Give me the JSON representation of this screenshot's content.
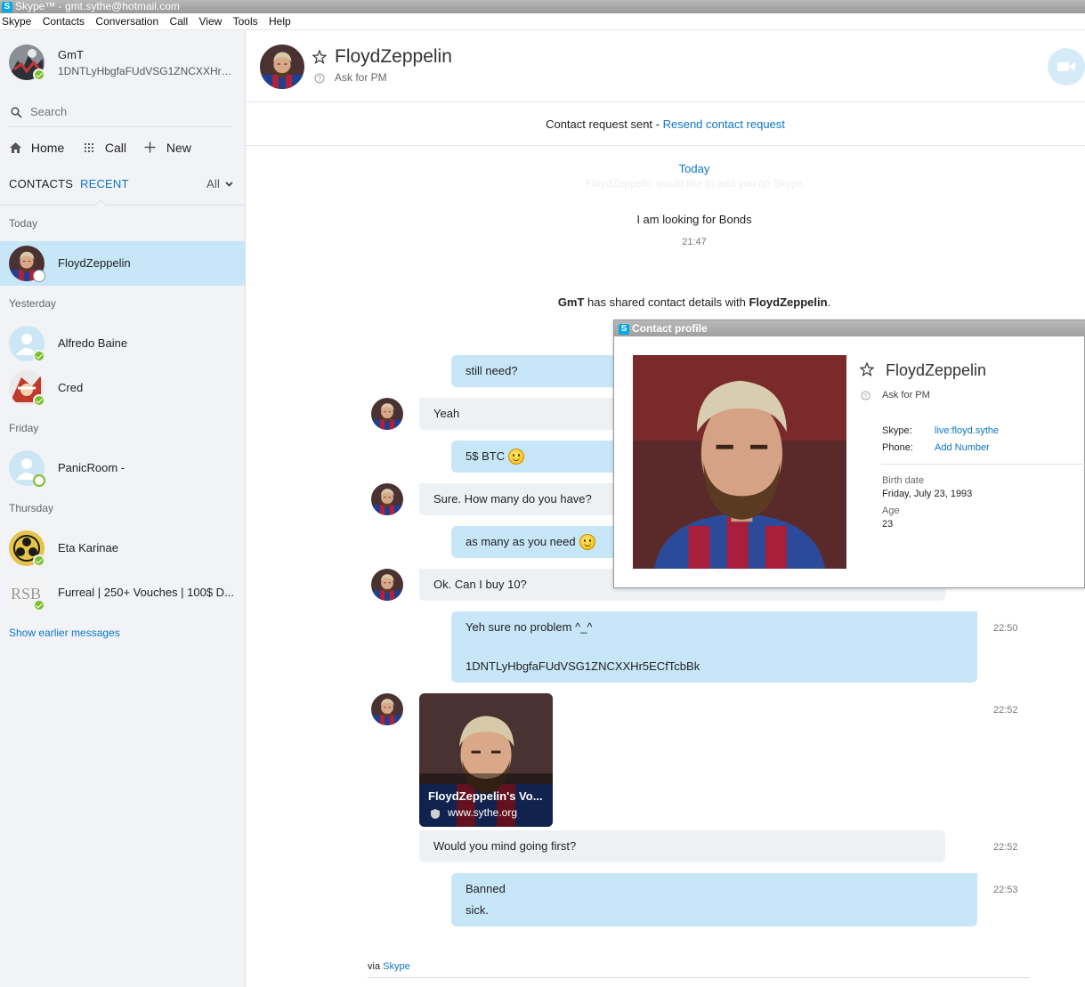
{
  "window": {
    "title": "Skype™ - gmt.sythe@hotmail.com"
  },
  "menu": [
    "Skype",
    "Contacts",
    "Conversation",
    "Call",
    "View",
    "Tools",
    "Help"
  ],
  "me": {
    "name": "GmT",
    "mood": "1DNTLyHbgfaFUdVSG1ZNCXXHr5E..."
  },
  "search": {
    "placeholder": "Search"
  },
  "nav": {
    "home": "Home",
    "call": "Call",
    "new": "New"
  },
  "tabs": {
    "contacts": "CONTACTS",
    "recent": "RECENT",
    "filter": "All"
  },
  "groups": {
    "today": "Today",
    "yesterday": "Yesterday",
    "friday": "Friday",
    "thursday": "Thursday"
  },
  "contacts": [
    {
      "name": "FloydZeppelin"
    },
    {
      "name": "Alfredo Baine"
    },
    {
      "name": "Cred"
    },
    {
      "name": "PanicRoom -"
    },
    {
      "name": "Eta Karinae"
    },
    {
      "name": "Furreal | 250+ Vouches | 100$ D..."
    }
  ],
  "show_earlier": "Show earlier messages",
  "conversation": {
    "title": "FloydZeppelin",
    "mood": "Ask for PM",
    "request_text": "Contact request sent - ",
    "request_link": "Resend contact request",
    "day": "Today",
    "ghost": "FloydZeppelin would like to add you on Skype",
    "first_message": "I am looking for Bonds",
    "first_time": "21:47",
    "shared_prefix": "GmT",
    "shared_middle": " has shared contact details with ",
    "shared_target": "FloydZeppelin",
    "shared_suffix": "."
  },
  "messages": {
    "m1": "still need?",
    "m2": "Yeah",
    "m3": "5$ BTC",
    "m4": "Sure. How many do you have?",
    "m5": "as many as you need",
    "m6": "Ok. Can I buy 10?",
    "m7_line1": "Yeh sure no problem ^_^",
    "m7_line2": "1DNTLyHbgfaFUdVSG1ZNCXXHr5ECfTcbBk",
    "m7_time": "22:50",
    "card_time": "22:52",
    "card_title": "FloydZeppelin's Vo...",
    "card_url": "www.sythe.org",
    "m8": "Would you mind going first?",
    "m8_time": "22:52",
    "m9_line1": "Banned",
    "m9_line2": "sick.",
    "m9_time": "22:53"
  },
  "footer": {
    "via": "via ",
    "link": "Skype"
  },
  "profile": {
    "title": "Contact profile",
    "name": "FloydZeppelin",
    "mood": "Ask for PM",
    "skype_label": "Skype:",
    "skype_value": "live:floyd.sythe",
    "phone_label": "Phone:",
    "phone_value": "Add Number",
    "birth_label": "Birth date",
    "birth_value": "Friday, July 23, 1993",
    "age_label": "Age",
    "age_value": "23"
  },
  "colors": {
    "accent": "#0b76c5",
    "bubble_out": "#c7e7f8",
    "bubble_in": "#eef1f4",
    "online": "#7cbd2a"
  }
}
